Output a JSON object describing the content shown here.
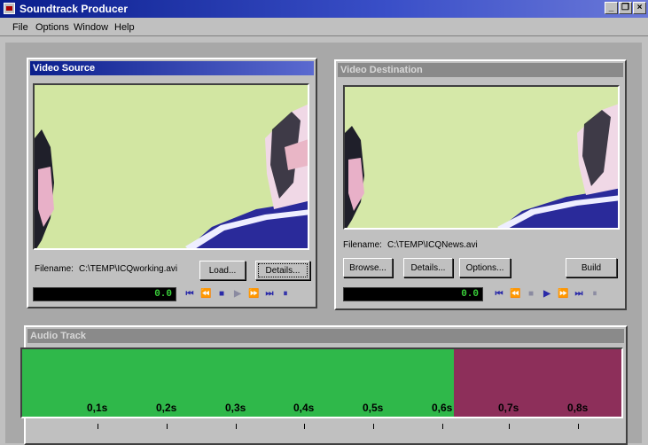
{
  "app": {
    "title": "Soundtrack Producer"
  },
  "menu": [
    "File",
    "Options",
    "Window",
    "Help"
  ],
  "window_buttons": [
    "_",
    "❐",
    "×"
  ],
  "source": {
    "title": "Video Source",
    "filename_label": "Filename:",
    "filename": "C:\\TEMP\\ICQworking.avi",
    "load": "Load...",
    "details": "Details...",
    "counter": "0.0"
  },
  "dest": {
    "title": "Video Destination",
    "filename_label": "Filename:",
    "filename": "C:\\TEMP\\ICQNews.avi",
    "browse": "Browse...",
    "details": "Details...",
    "options": "Options...",
    "build": "Build",
    "counter": "0.0"
  },
  "audio": {
    "title": "Audio Track",
    "ticks": [
      "0,1s",
      "0,2s",
      "0,3s",
      "0,4s",
      "0,5s",
      "0,6s",
      "0,7s",
      "0,8s"
    ],
    "segments": [
      {
        "color": "#2fb84a",
        "fraction": 0.72
      },
      {
        "color": "#8d2f5a",
        "fraction": 0.28
      }
    ]
  },
  "transport_icons": [
    "skip-start-icon",
    "rewind-icon",
    "stop-icon",
    "play-icon",
    "fast-forward-icon",
    "skip-end-icon",
    "pause-icon"
  ]
}
